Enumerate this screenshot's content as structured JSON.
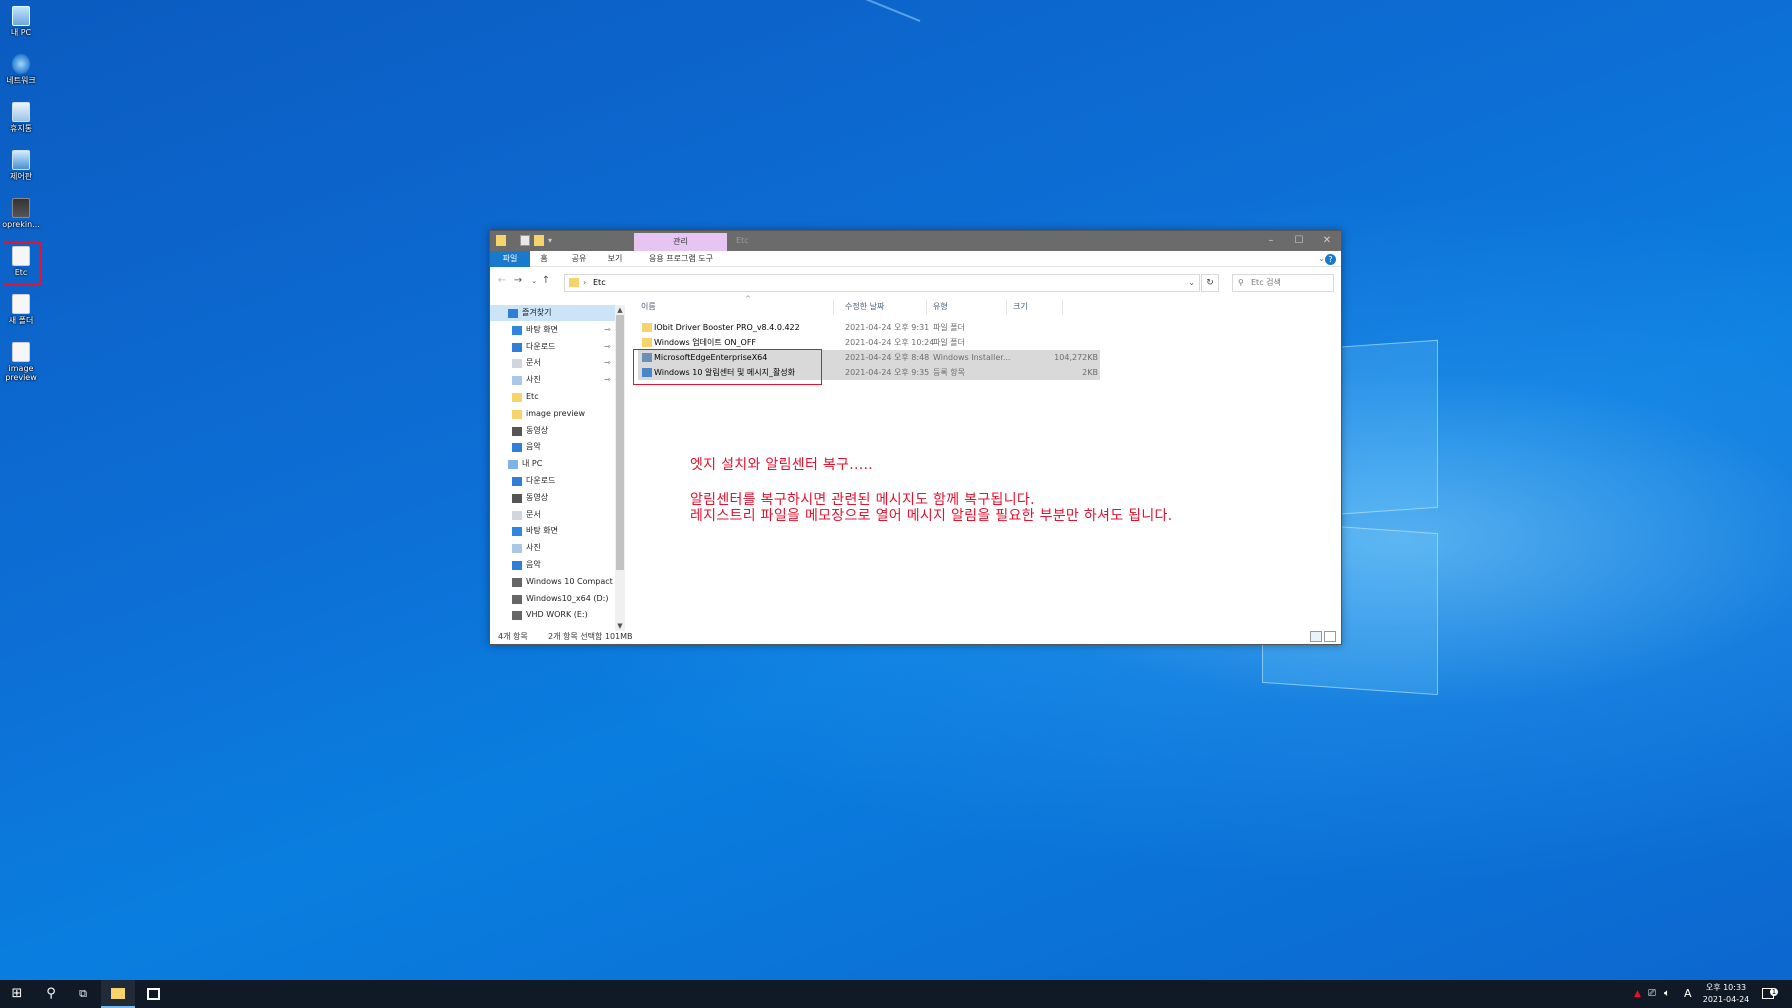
{
  "desktop": {
    "icons": [
      {
        "label": "내 PC",
        "icon": "this-pc-icon"
      },
      {
        "label": "네트워크",
        "icon": "network-icon"
      },
      {
        "label": "휴지통",
        "icon": "recycle-bin-icon"
      },
      {
        "label": "제어판",
        "icon": "control-panel-icon"
      },
      {
        "label": "oprekin...",
        "icon": "app-shortcut-icon"
      },
      {
        "label": "Etc",
        "icon": "file-icon"
      },
      {
        "label": "새 폴더",
        "icon": "file-icon"
      },
      {
        "label": "image preview",
        "icon": "file-icon"
      }
    ]
  },
  "window": {
    "contextual_tab": "관리",
    "title": "Etc",
    "controls": {
      "minimize": "–",
      "maximize": "☐",
      "close": "✕"
    }
  },
  "ribbon": {
    "tabs": [
      "파일",
      "홈",
      "공유",
      "보기",
      "응용 프로그램 도구"
    ],
    "help": "?"
  },
  "address": {
    "path_label": "Etc",
    "search_placeholder": "Etc 검색"
  },
  "nav": {
    "items": [
      {
        "label": "즐겨찾기",
        "icon": "star-icon",
        "level": 0,
        "pinned": false,
        "selected": true
      },
      {
        "label": "바탕 화면",
        "icon": "desktop-icon",
        "level": 1,
        "pinned": true
      },
      {
        "label": "다운로드",
        "icon": "download-icon",
        "level": 1,
        "pinned": true
      },
      {
        "label": "문서",
        "icon": "document-icon",
        "level": 1,
        "pinned": true
      },
      {
        "label": "사진",
        "icon": "pictures-icon",
        "level": 1,
        "pinned": true
      },
      {
        "label": "Etc",
        "icon": "folder-icon",
        "level": 1,
        "pinned": false
      },
      {
        "label": "image preview",
        "icon": "folder-icon",
        "level": 1,
        "pinned": false
      },
      {
        "label": "동영상",
        "icon": "video-icon",
        "level": 1,
        "pinned": false
      },
      {
        "label": "음악",
        "icon": "music-icon",
        "level": 1,
        "pinned": false
      },
      {
        "label": "내 PC",
        "icon": "this-pc-icon",
        "level": 0,
        "pinned": false
      },
      {
        "label": "다운로드",
        "icon": "download-icon",
        "level": 1,
        "pinned": false
      },
      {
        "label": "동영상",
        "icon": "video-icon",
        "level": 1,
        "pinned": false
      },
      {
        "label": "문서",
        "icon": "document-icon",
        "level": 1,
        "pinned": false
      },
      {
        "label": "바탕 화면",
        "icon": "desktop-icon",
        "level": 1,
        "pinned": false
      },
      {
        "label": "사진",
        "icon": "pictures-icon",
        "level": 1,
        "pinned": false
      },
      {
        "label": "음악",
        "icon": "music-icon",
        "level": 1,
        "pinned": false
      },
      {
        "label": "Windows 10 Compact",
        "icon": "drive-icon",
        "level": 1,
        "pinned": false
      },
      {
        "label": "Windows10_x64 (D:)",
        "icon": "drive-icon",
        "level": 1,
        "pinned": false
      },
      {
        "label": "VHD WORK (E:)",
        "icon": "drive-icon",
        "level": 1,
        "pinned": false
      }
    ]
  },
  "columns": [
    "이름",
    "수정한 날짜",
    "유형",
    "크기"
  ],
  "files": [
    {
      "name": "IObit Driver Booster PRO_v8.4.0.422",
      "date": "2021-04-24 오후 9:31",
      "type": "파일 폴더",
      "size": "",
      "icon": "folder-icon",
      "selected": false
    },
    {
      "name": "Windows 업데이트 ON_OFF",
      "date": "2021-04-24 오후 10:24",
      "type": "파일 폴더",
      "size": "",
      "icon": "folder-icon",
      "selected": false
    },
    {
      "name": "MicrosoftEdgeEnterpriseX64",
      "date": "2021-04-24 오후 8:48",
      "type": "Windows Installer...",
      "size": "104,272KB",
      "icon": "msi-installer-icon",
      "selected": true
    },
    {
      "name": "Windows 10 알림센터 및 메시지_활성화",
      "date": "2021-04-24 오후 9:35",
      "type": "등록 항목",
      "size": "2KB",
      "icon": "registry-file-icon",
      "selected": true
    }
  ],
  "annotation": {
    "line1": "엣지 설치와 알림센터 복구.....",
    "line2": "알림센터를 복구하시면 관련된 메시지도 함께 복구됩니다.",
    "line3": "레지스트리 파일을 메모장으로 열어 메시지 알림을 필요한 부분만 하셔도 됩니다.",
    "color": "#e8112d"
  },
  "status": {
    "count": "4개 항목",
    "selection": "2개 항목 선택함 101MB"
  },
  "taskbar": {
    "clock_time": "오후 10:33",
    "clock_date": "2021-04-24",
    "ime": "A",
    "notification_count": "1"
  },
  "colors": {
    "accent": "#1979ca",
    "highlight_box": "#e8112d",
    "selection": "#d9d9d9"
  }
}
